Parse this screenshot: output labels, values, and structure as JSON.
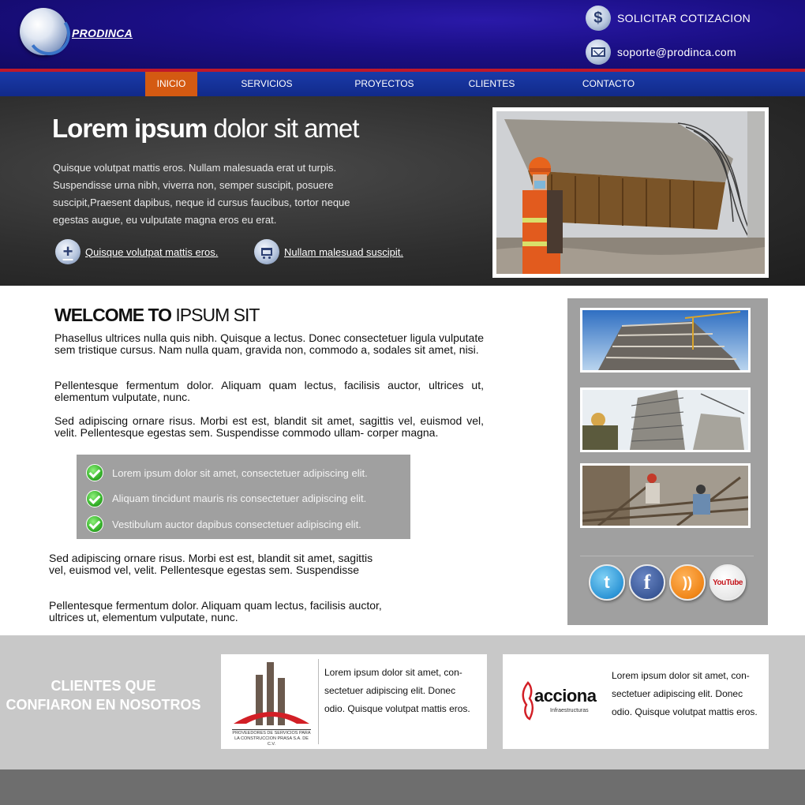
{
  "header": {
    "logo_text": "PRODINCA",
    "quote_label": "SOLICITAR COTIZACION",
    "quote_icon": "dollar-icon",
    "support_email": "soporte@prodinca.com",
    "support_icon": "envelope-icon"
  },
  "nav": {
    "items": [
      {
        "label": "INICIO",
        "active": true
      },
      {
        "label": "SERVICIOS",
        "active": false
      },
      {
        "label": "PROYECTOS",
        "active": false
      },
      {
        "label": "CLIENTES",
        "active": false
      },
      {
        "label": "CONTACTO",
        "active": false
      }
    ]
  },
  "hero": {
    "title_bold": "Lorem ipsum",
    "title_rest": " dolor sit amet",
    "text": "Quisque volutpat mattis eros. Nullam malesuada erat ut turpis. Suspendisse urna nibh, viverra non, semper suscipit, posuere suscipit,Praesent dapibus, neque id cursus faucibus, tortor neque egestas augue, eu vulputate magna eros eu erat.",
    "button1_label": "Quisque volutpat mattis eros.",
    "button1_icon": "plus-icon",
    "button2_label": "Nullam malesuad suscipit.",
    "button2_icon": "cart-icon"
  },
  "main": {
    "welcome_bold": "WELCOME TO",
    "welcome_rest": " IPSUM SIT",
    "paragraphs": [
      "Phasellus ultrices nulla quis nibh. Quisque a lectus. Donec consectetuer ligula vulputate sem tristique cursus. Nam nulla quam, gravida non, commodo a, sodales sit amet, nisi.",
      "Pellentesque fermentum dolor. Aliquam quam lectus, facilisis auctor, ultrices ut, elementum vulputate, nunc.",
      "Sed adipiscing ornare risus. Morbi est est, blandit sit amet, sagittis vel, euismod vel, velit. Pellentesque egestas sem. Suspendisse commodo ullam- corper magna."
    ],
    "checklist": [
      "Lorem ipsum dolor sit amet, consectetuer adipiscing elit.",
      "Aliquam tincidunt mauris ris consectetuer adipiscing elit.",
      "Vestibulum auctor dapibus consectetuer adipiscing elit."
    ],
    "lower_paragraphs": [
      "Sed adipiscing ornare risus. Morbi est est, blandit sit amet, sagittis vel, euismod vel, velit. Pellentesque egestas sem. Suspendisse",
      "Pellentesque fermentum dolor. Aliquam quam lectus, facilisis auctor, ultrices ut, elementum vulputate, nunc."
    ]
  },
  "sidebar": {
    "social": [
      "twitter-icon",
      "facebook-icon",
      "rss-icon",
      "youtube-icon"
    ],
    "youtube_text": "YouTube"
  },
  "clients": {
    "title_line1": "CLIENTES QUE",
    "title_line2": "CONFIARON EN NOSOTROS",
    "card1_caption": "PROVEEDORES DE SERVICIOS PARA LA CONSTRUCCION PRASA S.A. DE C.V.",
    "card1_text": "Lorem ipsum dolor sit amet, con- sectetuer adipiscing elit. Donec odio. Quisque volutpat mattis eros.",
    "card2_logo_main": "acciona",
    "card2_logo_sub": "Infraestructuras",
    "card2_text": "Lorem ipsum dolor sit amet, con- sectetuer adipiscing elit. Donec odio. Quisque volutpat mattis eros."
  },
  "colors": {
    "header_blue": "#1b0f86",
    "nav_active": "#d45a12",
    "nav_red_stripe": "#c0182a",
    "panel_gray": "#a0a0a0",
    "clients_band": "#c8c8c8",
    "footer": "#6e6e6e"
  }
}
